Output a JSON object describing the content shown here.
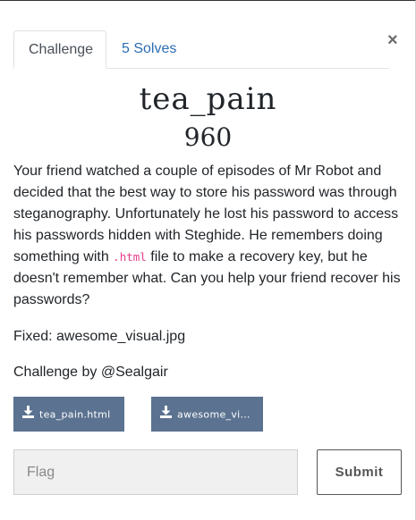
{
  "tabs": {
    "challenge": "Challenge",
    "solves": "5 Solves"
  },
  "close_label": "×",
  "challenge": {
    "name": "tea_pain",
    "points": "960",
    "description_before": "Your friend watched a couple of episodes of Mr Robot and decided that the best way to store his password was through steganography. Unfortunately he lost his password to access his passwords hidden with Steghide. He remembers doing something with ",
    "description_code": ".html",
    "description_after": " file to make a recovery key, but he doesn't remember what. Can you help your friend recover his passwords?",
    "fixed_line": "Fixed: awesome_visual.jpg",
    "author_line": "Challenge by @Sealgair"
  },
  "files": [
    {
      "name": "tea_pain.html",
      "icon": "download-icon"
    },
    {
      "name": "awesome_vi…",
      "icon": "download-icon"
    }
  ],
  "flag_input": {
    "placeholder": "Flag",
    "value": ""
  },
  "submit_label": "Submit",
  "colors": {
    "file_button_bg": "#5b7290",
    "tab_link": "#2c6db4",
    "code_text": "#e83e8c"
  }
}
